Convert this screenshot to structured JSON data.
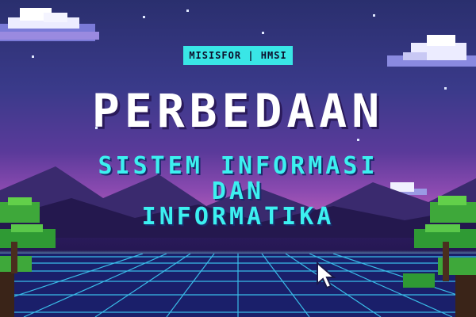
{
  "badge": {
    "label": "MISISFOR | HMSI"
  },
  "title": {
    "main": "PERBEDAAN"
  },
  "subtitle": {
    "line1": "SISTEM INFORMASI",
    "line2": "DAN",
    "line3": "INFORMATIKA"
  },
  "colors": {
    "accent": "#39e6e6",
    "title": "#ffffff",
    "subtitle": "#3cf0f0",
    "sky_top": "#2a2f6e",
    "sky_glow": "#b05ab8",
    "grid": "#3fd8ff"
  },
  "icons": [
    "cloud-icon",
    "tree-icon",
    "cursor-arrow-icon",
    "mountain-icon",
    "star-icon"
  ]
}
